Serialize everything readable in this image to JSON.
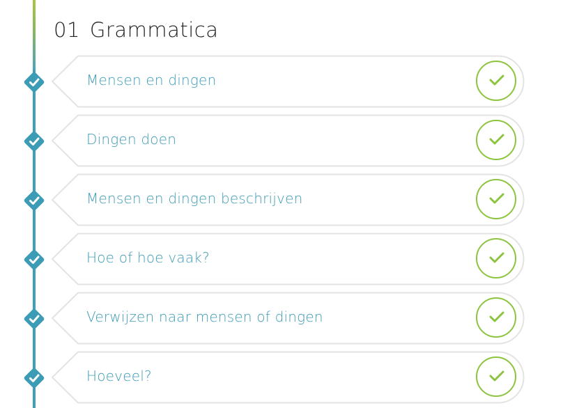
{
  "section": {
    "number": "01",
    "title": "Grammatica"
  },
  "colors": {
    "accent_teal": "#3d9cb5",
    "complete_green": "#8cc43f",
    "title_text": "#222222"
  },
  "lessons": [
    {
      "label": "Mensen en dingen",
      "status": "completed"
    },
    {
      "label": "Dingen doen",
      "status": "completed"
    },
    {
      "label": "Mensen en dingen beschrijven",
      "status": "completed"
    },
    {
      "label": "Hoe of hoe vaak?",
      "status": "completed"
    },
    {
      "label": "Verwijzen naar mensen of dingen",
      "status": "completed"
    },
    {
      "label": "Hoeveel?",
      "status": "completed"
    }
  ]
}
